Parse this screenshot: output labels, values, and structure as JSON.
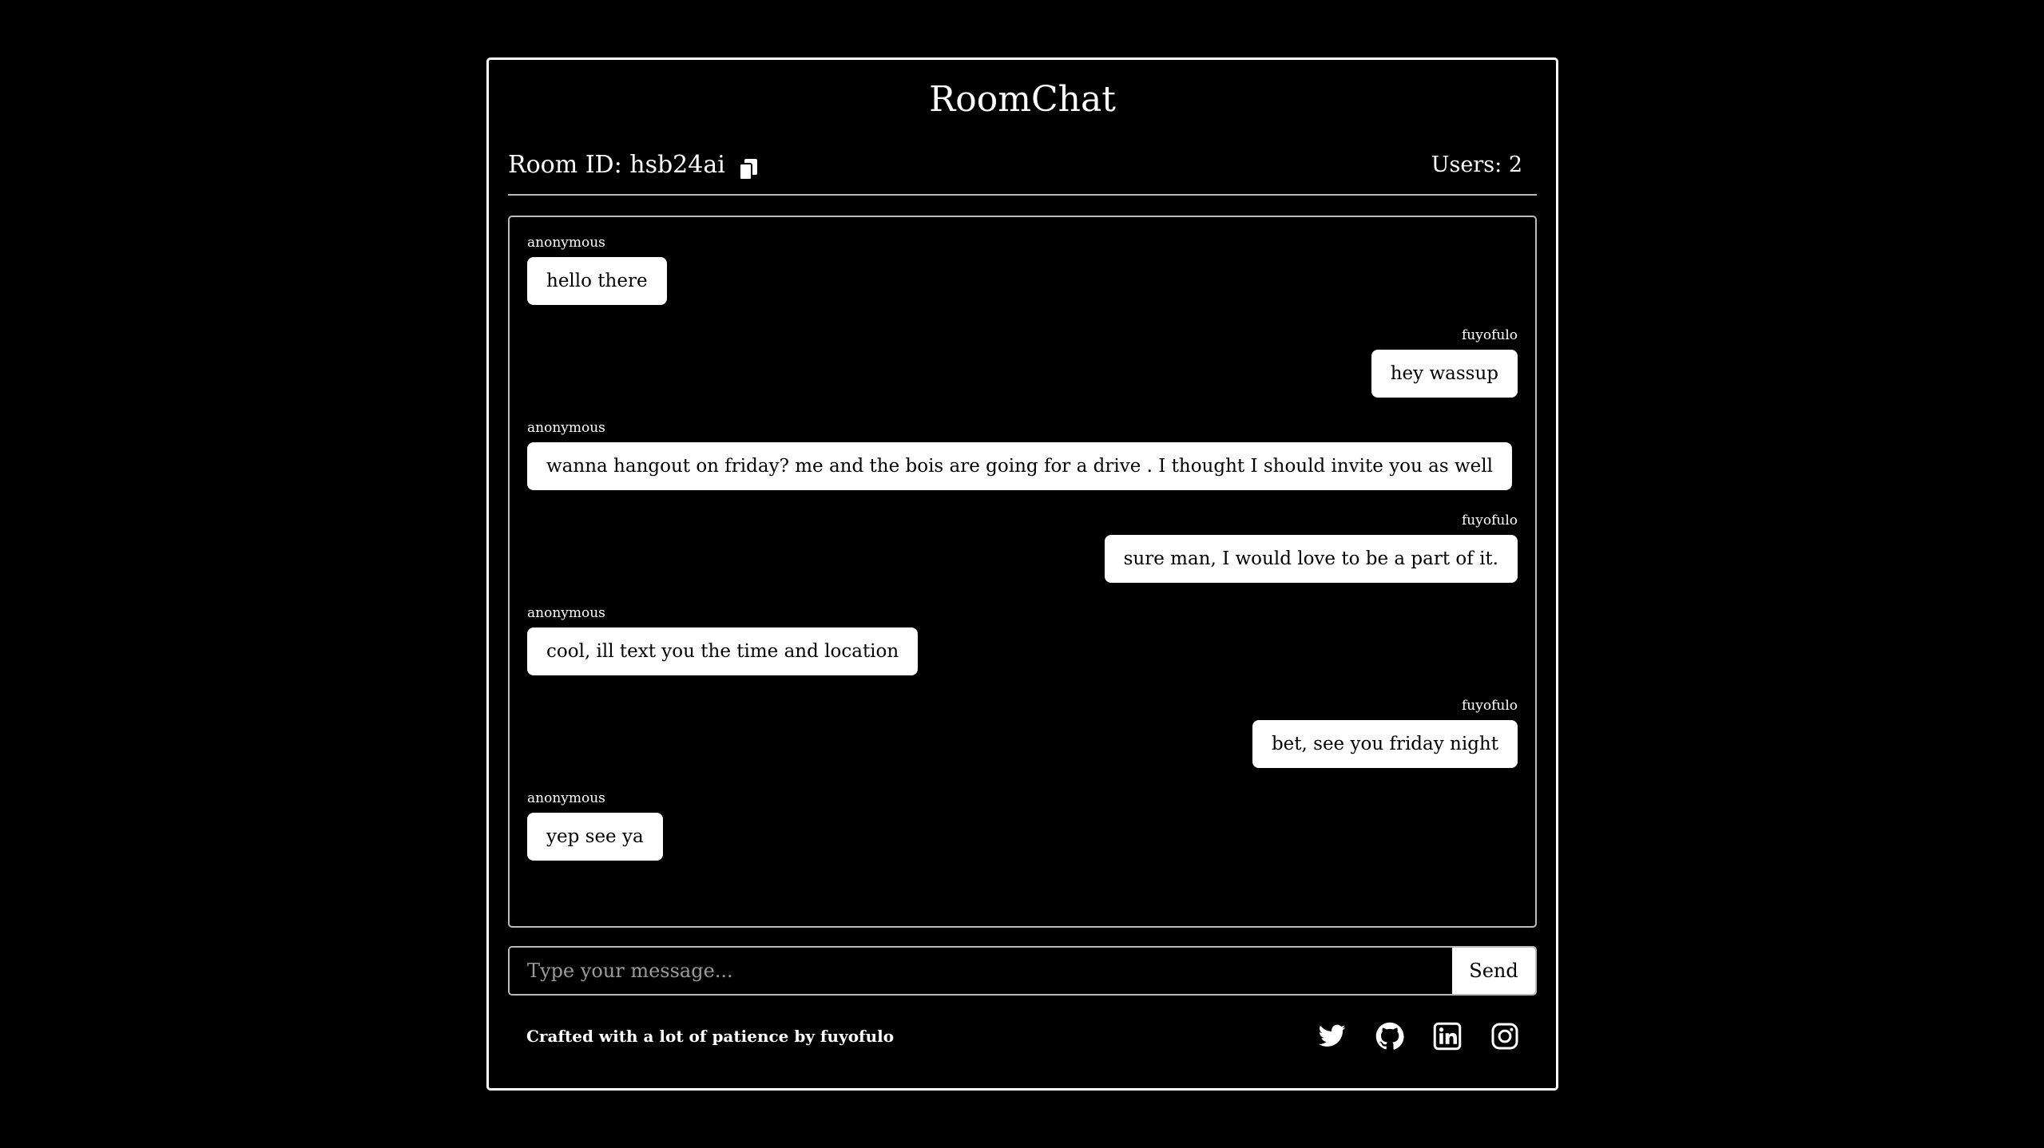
{
  "app": {
    "title": "RoomChat"
  },
  "room": {
    "id_label": "Room ID: hsb24ai",
    "copy_icon": "copy-icon",
    "users_label": "Users: 2"
  },
  "messages": [
    {
      "author": "anonymous",
      "text": "hello there",
      "self": false
    },
    {
      "author": "fuyofulo",
      "text": "hey wassup",
      "self": true
    },
    {
      "author": "anonymous",
      "text": "wanna hangout on friday? me and the bois are going for a drive . I thought I should invite you as well",
      "self": false
    },
    {
      "author": "fuyofulo",
      "text": "sure man, I would love to be a part of it.",
      "self": true
    },
    {
      "author": "anonymous",
      "text": "cool, ill text you the time and location",
      "self": false
    },
    {
      "author": "fuyofulo",
      "text": "bet, see you friday night",
      "self": true
    },
    {
      "author": "anonymous",
      "text": "yep see ya",
      "self": false
    }
  ],
  "composer": {
    "placeholder": "Type your message...",
    "value": "",
    "send_label": "Send"
  },
  "footer": {
    "credit": "Crafted with a lot of patience by fuyofulo",
    "socials": [
      "twitter-icon",
      "github-icon",
      "linkedin-icon",
      "instagram-icon"
    ]
  },
  "colors": {
    "background": "#000000",
    "foreground": "#ffffff",
    "bubble": "#ffffff",
    "bubble_text": "#000000"
  }
}
